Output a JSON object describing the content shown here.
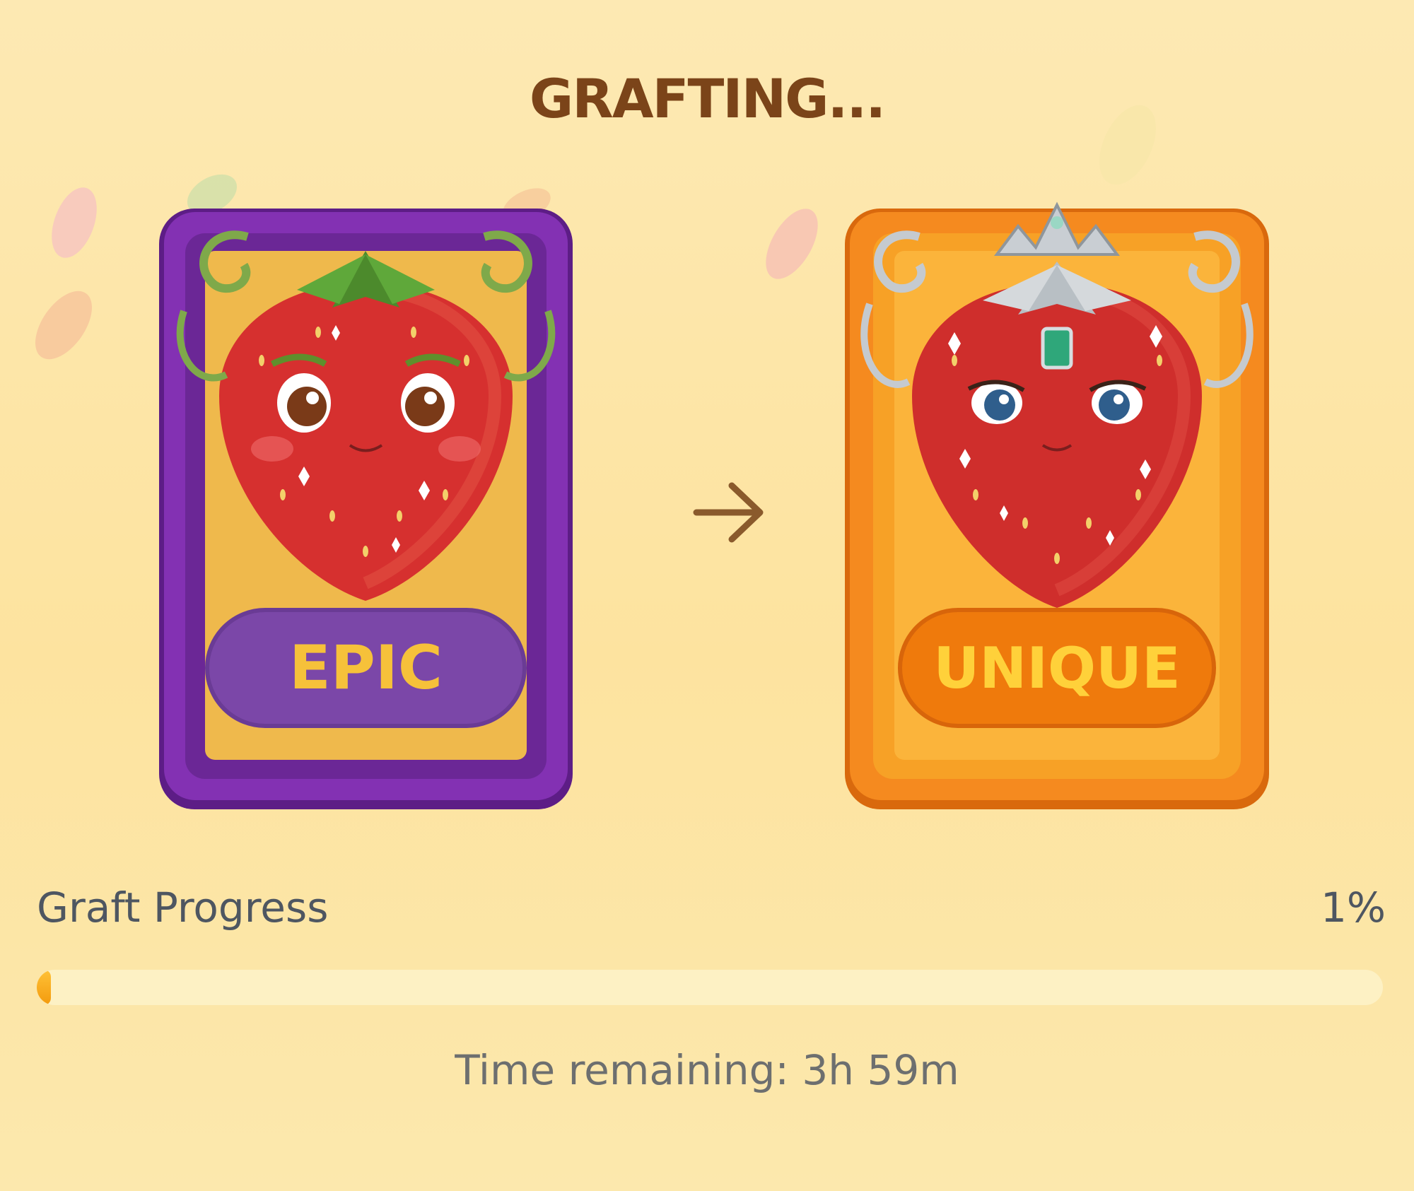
{
  "header": {
    "title": "GRAFTING..."
  },
  "cards": {
    "from": {
      "rarity": "EPIC",
      "color": "#7a2ea6"
    },
    "to": {
      "rarity": "UNIQUE",
      "color": "#f58a1f"
    }
  },
  "progress": {
    "label": "Graft Progress",
    "percent_text": "1%",
    "fraction": 0.01,
    "time_remaining": "Time remaining: 3h 59m"
  },
  "colors": {
    "title": "#7b4419",
    "progress_fill": "#f7a51a",
    "progress_track": "#fdf1c4"
  }
}
